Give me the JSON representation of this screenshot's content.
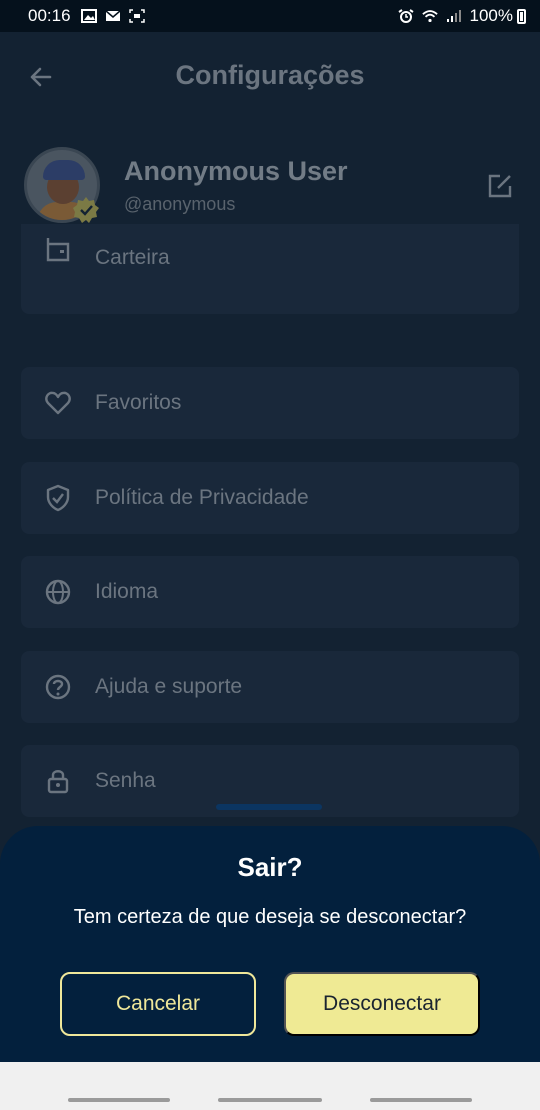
{
  "status_bar": {
    "time": "00:16",
    "battery": "100%",
    "left_icons": [
      "image-icon",
      "mail-icon",
      "screenshot-icon"
    ],
    "right_icons": [
      "alarm-icon",
      "wifi-icon",
      "signal-icon",
      "battery-icon"
    ]
  },
  "app_bar": {
    "title": "Configurações",
    "back_icon": "arrow-left-icon"
  },
  "profile": {
    "name": "Anonymous User",
    "handle": "@anonymous",
    "edit_icon": "edit-icon"
  },
  "menu": {
    "items": [
      {
        "label": "Carteira",
        "icon": "wallet-icon"
      },
      {
        "label": "Favoritos",
        "icon": "heart-icon"
      },
      {
        "label": "Política de Privacidade",
        "icon": "shield-check-icon"
      },
      {
        "label": "Idioma",
        "icon": "globe-icon"
      },
      {
        "label": "Ajuda e suporte",
        "icon": "help-circle-icon"
      },
      {
        "label": "Senha",
        "icon": "lock-icon"
      }
    ]
  },
  "dialog": {
    "title": "Sair?",
    "message": "Tem certeza de que deseja se desconectar?",
    "cancel_label": "Cancelar",
    "confirm_label": "Desconectar"
  },
  "colors": {
    "accent": "#efea94",
    "sheet_background": "#03203d",
    "app_background": "#132232"
  }
}
